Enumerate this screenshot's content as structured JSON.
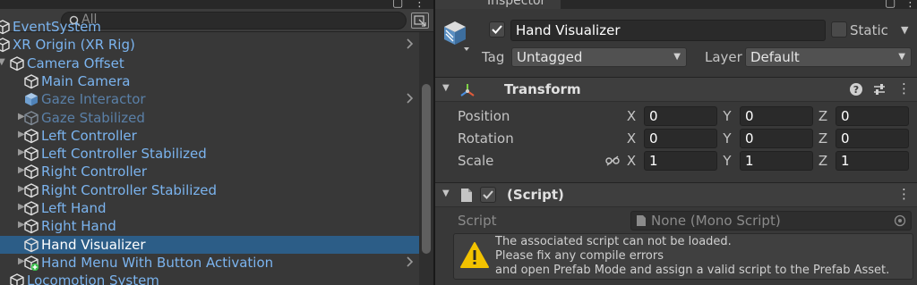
{
  "hierarchy": {
    "search_placeholder": "All",
    "items": [
      {
        "label": "EventSystem",
        "indent": 0,
        "arrow": "",
        "style": "blue",
        "chevron": false,
        "selected": false,
        "partial": true
      },
      {
        "label": "XR Origin (XR Rig)",
        "indent": 0,
        "arrow": "",
        "style": "blue",
        "chevron": true,
        "selected": false
      },
      {
        "label": "Camera Offset",
        "indent": 1,
        "arrow": "down",
        "style": "blue",
        "chevron": false,
        "selected": false
      },
      {
        "label": "Main Camera",
        "indent": 2,
        "arrow": "",
        "style": "blue",
        "chevron": false,
        "selected": false
      },
      {
        "label": "Gaze Interactor",
        "indent": 2,
        "arrow": "",
        "style": "dim",
        "chevron": true,
        "selected": false,
        "solid": true
      },
      {
        "label": "Gaze Stabilized",
        "indent": 2,
        "arrow": "right",
        "style": "dim",
        "chevron": false,
        "selected": false
      },
      {
        "label": "Left Controller",
        "indent": 2,
        "arrow": "right",
        "style": "blue",
        "chevron": false,
        "selected": false
      },
      {
        "label": "Left Controller Stabilized",
        "indent": 2,
        "arrow": "right",
        "style": "blue",
        "chevron": false,
        "selected": false
      },
      {
        "label": "Right Controller",
        "indent": 2,
        "arrow": "right",
        "style": "blue",
        "chevron": false,
        "selected": false
      },
      {
        "label": "Right Controller Stabilized",
        "indent": 2,
        "arrow": "right",
        "style": "blue",
        "chevron": false,
        "selected": false
      },
      {
        "label": "Left Hand",
        "indent": 2,
        "arrow": "right",
        "style": "blue",
        "chevron": false,
        "selected": false
      },
      {
        "label": "Right Hand",
        "indent": 2,
        "arrow": "right",
        "style": "blue",
        "chevron": false,
        "selected": false
      },
      {
        "label": "Hand Visualizer",
        "indent": 2,
        "arrow": "",
        "style": "white",
        "chevron": false,
        "selected": true
      },
      {
        "label": "Hand Menu With Button Activation",
        "indent": 2,
        "arrow": "right",
        "style": "blue",
        "chevron": true,
        "selected": false,
        "badge": true
      },
      {
        "label": "Locomotion System",
        "indent": 1,
        "arrow": "",
        "style": "blue",
        "chevron": false,
        "selected": false,
        "partial": true
      }
    ]
  },
  "inspector": {
    "tab_label": "Inspector",
    "object_name": "Hand Visualizer",
    "active": true,
    "static_label": "Static",
    "static_checked": false,
    "tag_label": "Tag",
    "tag_value": "Untagged",
    "layer_label": "Layer",
    "layer_value": "Default",
    "transform": {
      "title": "Transform",
      "rows": [
        {
          "label": "Position",
          "x": "0",
          "y": "0",
          "z": "0"
        },
        {
          "label": "Rotation",
          "x": "0",
          "y": "0",
          "z": "0"
        },
        {
          "label": "Scale",
          "x": "1",
          "y": "1",
          "z": "1"
        }
      ],
      "axis_x": "X",
      "axis_y": "Y",
      "axis_z": "Z"
    },
    "script_component": {
      "title": "(Script)",
      "enabled": true,
      "field_label": "Script",
      "field_value": "None (Mono Script)",
      "warning_lines": [
        "The associated script can not be loaded.",
        "Please fix any compile errors",
        "and open Prefab Mode and assign a valid script to the Prefab Asset."
      ]
    }
  },
  "colors": {
    "selection": "#2c5d87",
    "object_label": "#7bb4ef",
    "disabled_label": "#5a80a8",
    "warning": "#f2c200"
  }
}
